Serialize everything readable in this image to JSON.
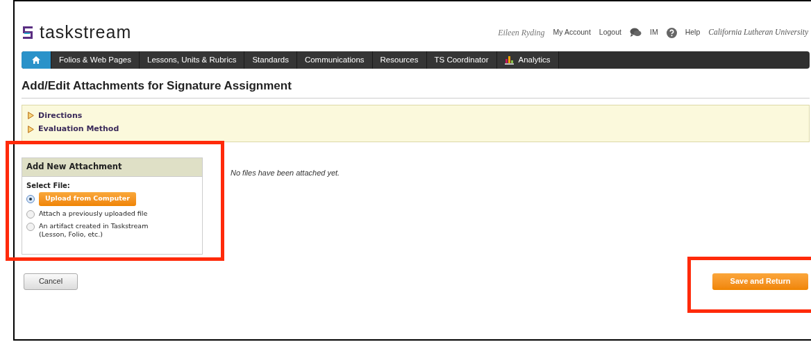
{
  "header": {
    "logo": "taskstream",
    "user": "Eileen Ryding",
    "links": [
      {
        "label": "My Account",
        "kind": "text"
      },
      {
        "label": "Logout",
        "kind": "text"
      },
      {
        "label": "IM",
        "kind": "chat"
      },
      {
        "label": "Help",
        "kind": "help"
      }
    ],
    "institution": "California Lutheran University"
  },
  "nav": [
    {
      "kind": "home",
      "selected": true
    },
    {
      "label": "Folios & Web Pages",
      "kind": "text",
      "selected": false
    },
    {
      "label": "Lessons, Units & Rubrics",
      "kind": "text",
      "selected": false
    },
    {
      "label": "Standards",
      "kind": "text",
      "selected": false
    },
    {
      "label": "Communications",
      "kind": "text",
      "selected": false
    },
    {
      "label": "Resources",
      "kind": "text",
      "selected": false
    },
    {
      "label": "TS Coordinator",
      "kind": "text",
      "selected": false
    },
    {
      "label": "Analytics",
      "kind": "chart",
      "selected": false
    }
  ],
  "page_title": "Add/Edit Attachments for Signature Assignment",
  "sections": [
    {
      "label": "Directions",
      "expanded": false
    },
    {
      "label": "Evaluation Method",
      "expanded": false
    }
  ],
  "attachment_panel": {
    "title": "Add New Attachment",
    "highlighted": true,
    "select_label": "Select File:",
    "options": [
      {
        "kind": "button",
        "label": "Upload from Computer",
        "selected": true
      },
      {
        "kind": "text",
        "label": "Attach a previously uploaded file",
        "selected": false
      },
      {
        "kind": "text",
        "label": "An artifact created in Taskstream (Lesson, Folio, etc.)",
        "selected": false
      }
    ]
  },
  "empty_message": "No files have been attached yet.",
  "cancel_button": "Cancel",
  "save_button": {
    "label": "Save and Return",
    "highlighted": true
  }
}
